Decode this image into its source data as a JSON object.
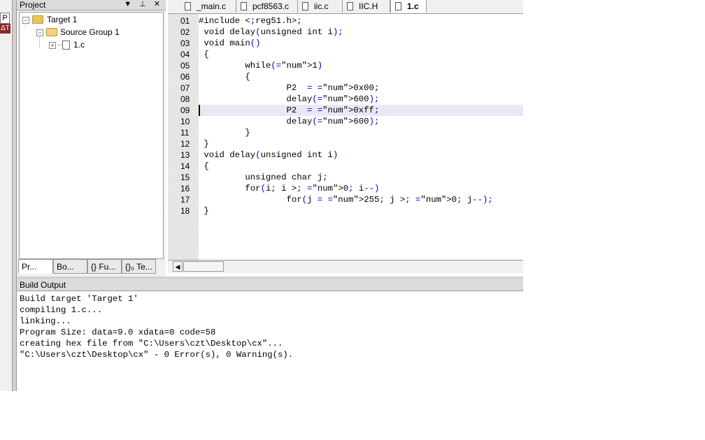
{
  "project_panel": {
    "title": "Project",
    "title_buttons": "▼ ⊥ ✕",
    "tree": {
      "target": "Target 1",
      "group": "Source Group 1",
      "file": "1.c"
    },
    "tabs": [
      "Pr...",
      "Bo...",
      "{} Fu...",
      "{}₀ Te..."
    ]
  },
  "left_strip": {
    "label_top": "P",
    "label_bottom": "ΔT"
  },
  "editor": {
    "tabs": [
      "_main.c",
      "pcf8563.c",
      "iic.c",
      "IIC.H",
      "1.c"
    ],
    "active_tab": "1.c",
    "line_numbers": [
      "01",
      "02",
      "03",
      "04",
      "05",
      "06",
      "07",
      "08",
      "09",
      "10",
      "11",
      "12",
      "13",
      "14",
      "15",
      "16",
      "17",
      "18"
    ],
    "highlighted_line": 9,
    "lines": [
      "#include <reg51.h>",
      " void delay(unsigned int i);",
      " void main()",
      " {",
      "         while(1)",
      "         {",
      "                 P2  = 0x00;",
      "                 delay(600);",
      "                 P2  = 0xff;",
      "                 delay(600);",
      "         }",
      " }",
      " void delay(unsigned int i)",
      " {",
      "         unsigned char j;",
      "         for(i; i > 0; i--)",
      "                 for(j = 255; j > 0; j--);",
      " }"
    ]
  },
  "build_output": {
    "title": "Build Output",
    "lines": [
      "Build target 'Target 1'",
      "compiling 1.c...",
      "linking...",
      "Program Size: data=9.0 xdata=0 code=58",
      "creating hex file from \"C:\\Users\\czt\\Desktop\\cx\"...",
      "\"C:\\Users\\czt\\Desktop\\cx\" - 0 Error(s), 0 Warning(s)."
    ]
  }
}
